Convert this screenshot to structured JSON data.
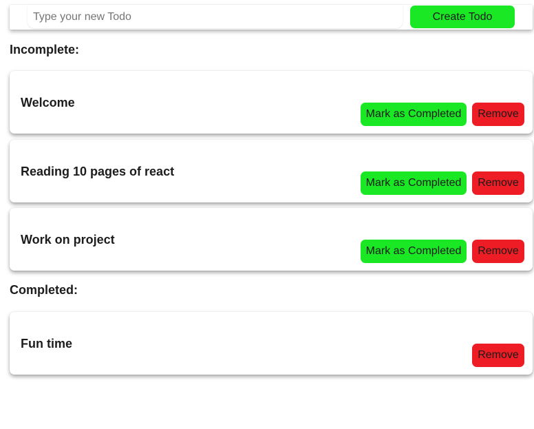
{
  "new_todo": {
    "placeholder": "Type your new Todo",
    "value": "",
    "create_label": "Create Todo"
  },
  "sections": {
    "incomplete_heading": "Incomplete:",
    "completed_heading": "Completed:"
  },
  "incomplete": [
    {
      "title": "Welcome",
      "complete_label": "Mark as Completed",
      "remove_label": "Remove"
    },
    {
      "title": "Reading 10 pages of react",
      "complete_label": "Mark as Completed",
      "remove_label": "Remove"
    },
    {
      "title": "Work on project",
      "complete_label": "Mark as Completed",
      "remove_label": "Remove"
    }
  ],
  "completed": [
    {
      "title": "Fun time",
      "remove_label": "Remove"
    }
  ],
  "colors": {
    "complete_button": "#1ae825",
    "remove_button": "#ee1c24",
    "create_button": "#1ae825"
  }
}
